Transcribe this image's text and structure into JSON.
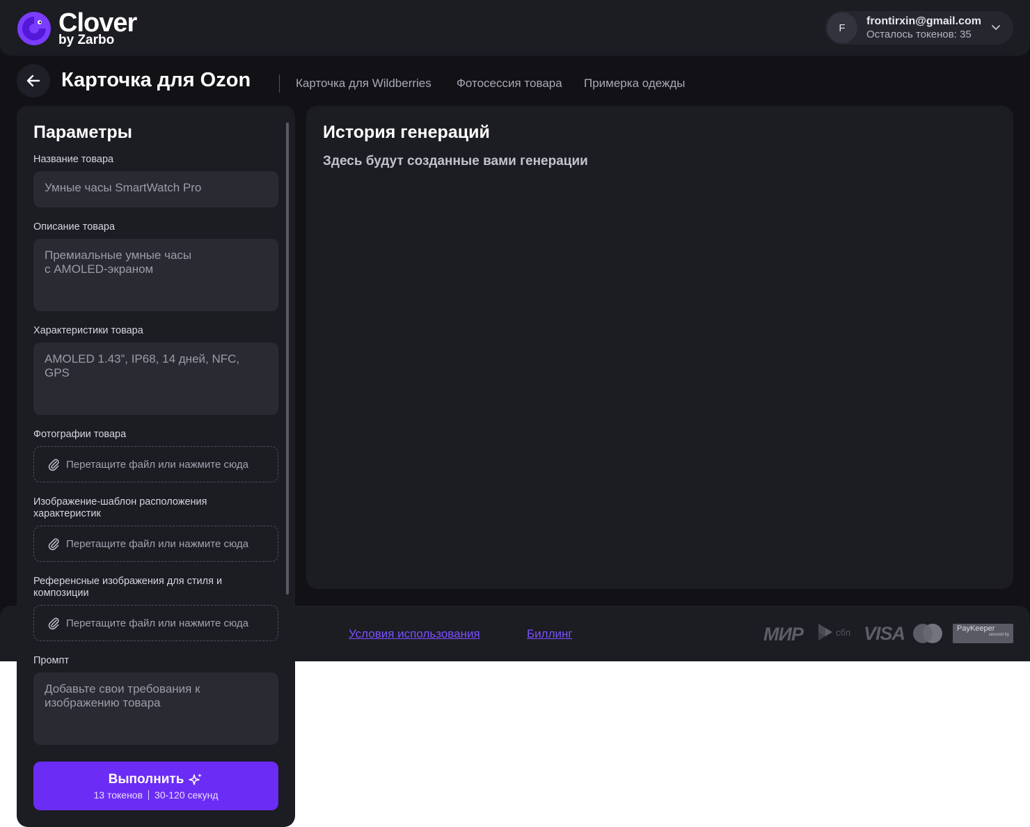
{
  "header": {
    "logo_name": "Clover",
    "logo_sub": "by Zarbo",
    "user": {
      "avatar_letter": "F",
      "email": "frontirxin@gmail.com",
      "tokens_text": "Осталось токенов: 35"
    }
  },
  "title_row": {
    "title": "Карточка для Ozon",
    "nav": [
      "Карточка для Wildberries",
      "Фотосессия товара",
      "Примерка одежды"
    ]
  },
  "params": {
    "title": "Параметры",
    "fields": {
      "name": {
        "label": "Название товара",
        "placeholder": "Умные часы SmartWatch Pro"
      },
      "description": {
        "label": "Описание товара",
        "placeholder": "Премиальные умные часы\nс AMOLED-экраном"
      },
      "specs": {
        "label": "Характеристики товара",
        "placeholder": "AMOLED 1.43”, IP68, 14 дней, NFC, GPS"
      },
      "photos": {
        "label": "Фотографии товара",
        "dropzone": "Перетащите файл или нажмите сюда"
      },
      "template": {
        "label": "Изображение-шаблон расположения характеристик",
        "dropzone": "Перетащите файл или нажмите сюда"
      },
      "references": {
        "label": "Референсные изображения для стиля и композиции",
        "dropzone": "Перетащите файл или нажмите сюда"
      },
      "prompt": {
        "label": "Промпт",
        "placeholder": "Добавьте свои требования к изображению товара"
      }
    },
    "run_button": {
      "label": "Выполнить",
      "tokens": "13 токенов",
      "duration": "30-120 секунд"
    }
  },
  "history": {
    "title": "История генераций",
    "empty_text": "Здесь будут созданные вами генерации"
  },
  "footer": {
    "links": [
      "Условия использования",
      "Биллинг"
    ],
    "payments": {
      "mir": "МИР",
      "sbp": "сбп",
      "visa": "VISA",
      "paykeeper": "PayKeeper",
      "paykeeper_sub": "secured by"
    }
  },
  "colors": {
    "accent": "#6b2cf5",
    "link": "#7b52ff",
    "panel": "#1c1c23",
    "background": "#111116"
  },
  "icons": [
    "back-arrow-icon",
    "chevron-down-icon",
    "paperclip-icon",
    "sparkle-icon",
    "mastercard-icon",
    "sbp-icon"
  ]
}
